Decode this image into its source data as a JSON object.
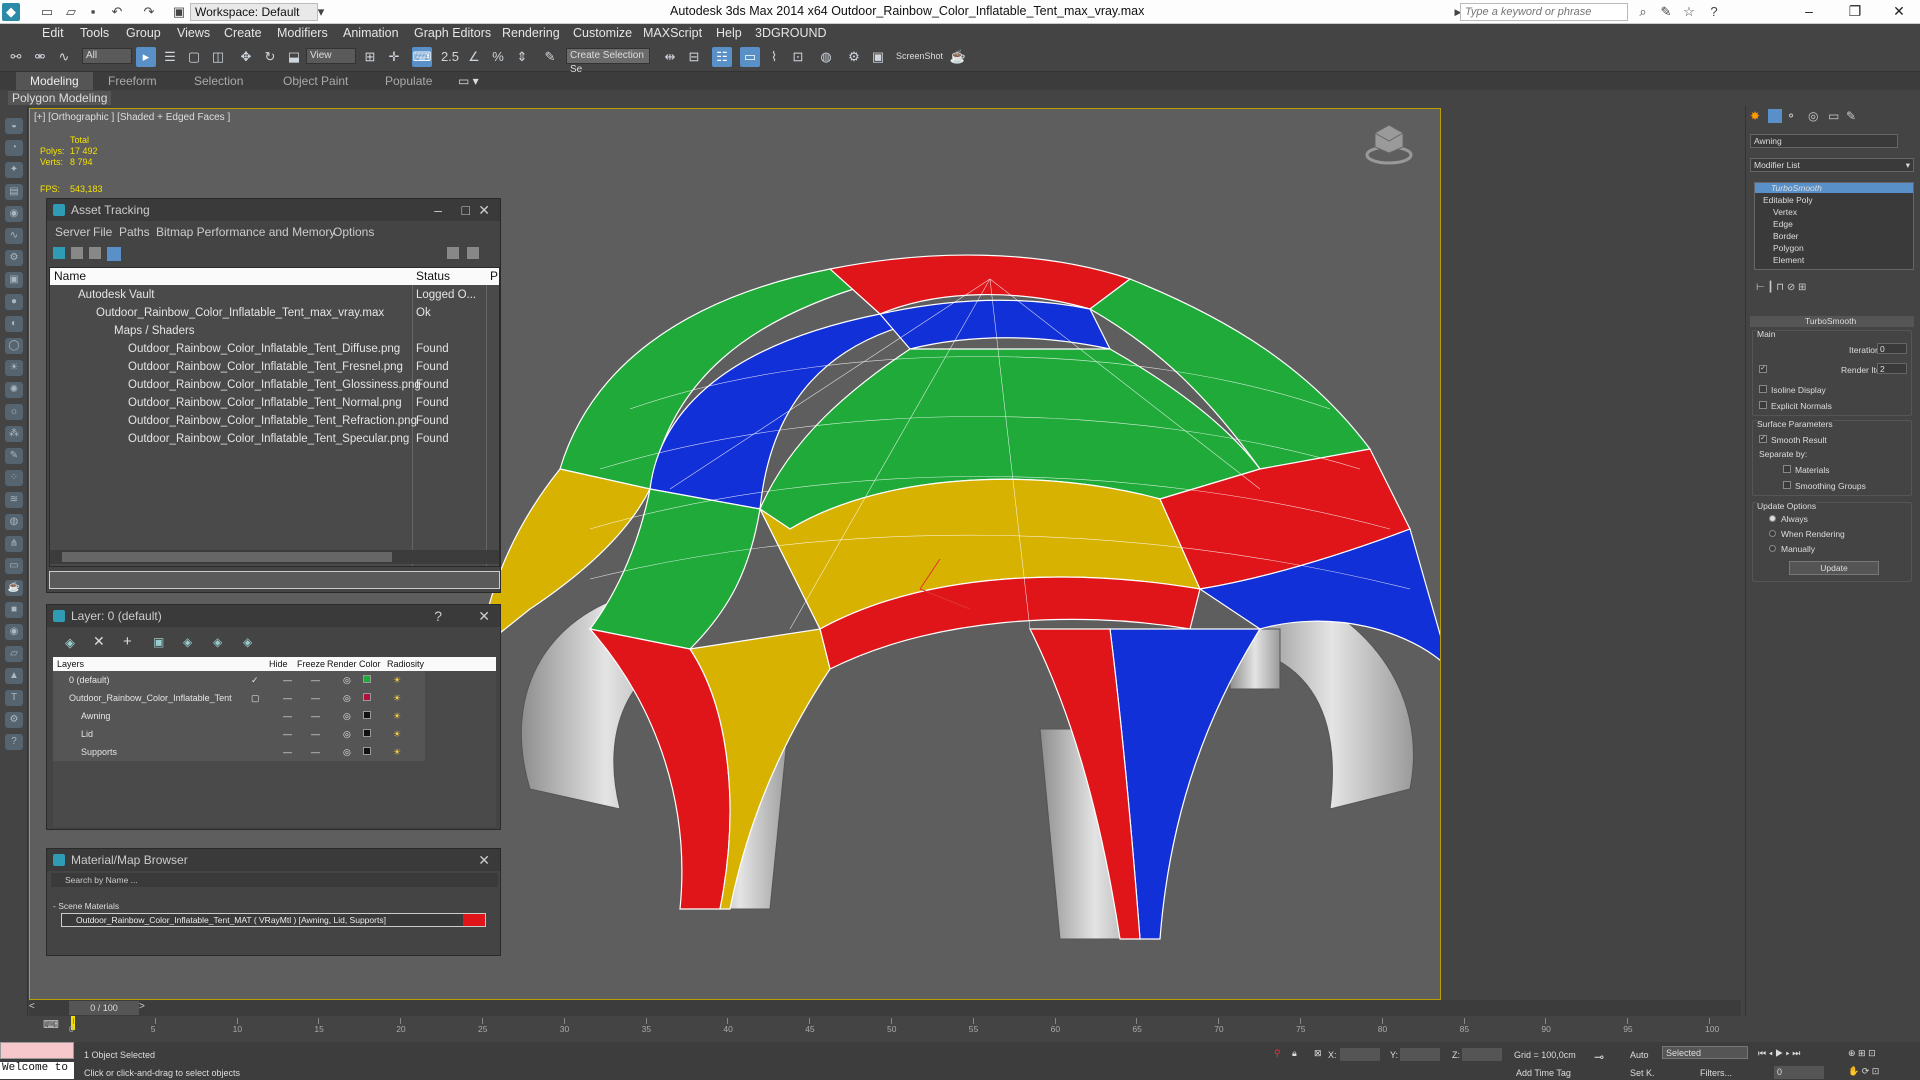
{
  "app": {
    "title": "Autodesk 3ds Max  2014 x64     Outdoor_Rainbow_Color_Inflatable_Tent_max_vray.max",
    "workspace": "Workspace: Default",
    "search_placeholder": "Type a keyword or phrase"
  },
  "menu": [
    "Edit",
    "Tools",
    "Group",
    "Views",
    "Create",
    "Modifiers",
    "Animation",
    "Graph Editors",
    "Rendering",
    "Customize",
    "MAXScript",
    "Help",
    "3DGROUND"
  ],
  "toolbar": {
    "filter_value": "All",
    "refcoord_value": "View",
    "named_sel_value": "Create Selection Se",
    "screenshot_label": "ScreenShot"
  },
  "ribbon": {
    "tabs": [
      "Modeling",
      "Freeform",
      "Selection",
      "Object Paint",
      "Populate"
    ],
    "active_tab": "Modeling",
    "sub_tab": "Polygon Modeling"
  },
  "viewport": {
    "label": "[+] [Orthographic ] [Shaded + Edged Faces ]",
    "stats_total": "Total",
    "polys_label": "Polys:",
    "polys_value": "17 492",
    "verts_label": "Verts:",
    "verts_value": "8 794",
    "fps_label": "FPS:",
    "fps_value": "543,183",
    "colors": {
      "green": "#1faa3a",
      "red": "#e0151a",
      "blue": "#1230d8",
      "yellow": "#d8b200",
      "grey": "#d2d2d2"
    }
  },
  "asset_tracking": {
    "title": "Asset Tracking",
    "menu": [
      "Server",
      "File",
      "Paths",
      "Bitmap Performance and Memory",
      "Options"
    ],
    "col_name": "Name",
    "col_status": "Status",
    "col_p": "P",
    "rows": [
      {
        "name": "Autodesk Vault",
        "status": "Logged O..."
      },
      {
        "name": "Outdoor_Rainbow_Color_Inflatable_Tent_max_vray.max",
        "status": "Ok"
      },
      {
        "name": "Maps / Shaders",
        "status": ""
      },
      {
        "name": "Outdoor_Rainbow_Color_Inflatable_Tent_Diffuse.png",
        "status": "Found"
      },
      {
        "name": "Outdoor_Rainbow_Color_Inflatable_Tent_Fresnel.png",
        "status": "Found"
      },
      {
        "name": "Outdoor_Rainbow_Color_Inflatable_Tent_Glossiness.png",
        "status": "Found"
      },
      {
        "name": "Outdoor_Rainbow_Color_Inflatable_Tent_Normal.png",
        "status": "Found"
      },
      {
        "name": "Outdoor_Rainbow_Color_Inflatable_Tent_Refraction.png",
        "status": "Found"
      },
      {
        "name": "Outdoor_Rainbow_Color_Inflatable_Tent_Specular.png",
        "status": "Found"
      }
    ]
  },
  "layer_panel": {
    "title": "Layer: 0 (default)",
    "help": "?",
    "cols": [
      "Layers",
      "Hide",
      "Freeze",
      "Render",
      "Color",
      "Radiosity"
    ],
    "rows": [
      {
        "name": "0 (default)",
        "color": "#1faa3a"
      },
      {
        "name": "Outdoor_Rainbow_Color_Inflatable_Tent",
        "color": "#b0103a"
      },
      {
        "name": "Awning",
        "color": "#111111"
      },
      {
        "name": "Lid",
        "color": "#111111"
      },
      {
        "name": "Supports",
        "color": "#111111"
      }
    ]
  },
  "material_browser": {
    "title": "Material/Map Browser",
    "search_placeholder": "Search by Name ...",
    "section": "- Scene Materials",
    "material": "Outdoor_Rainbow_Color_Inflatable_Tent_MAT ( VRayMtl ) [Awning, Lid, Supports]"
  },
  "command_panel": {
    "object_name": "Awning",
    "modifier_list": "Modifier List",
    "stack": [
      "TurboSmooth",
      "Editable Poly",
      "Vertex",
      "Edge",
      "Border",
      "Polygon",
      "Element"
    ],
    "rollout_title": "TurboSmooth",
    "main": "Main",
    "iterations_label": "Iterations:",
    "iterations_value": "0",
    "render_iters_label": "Render Iters:",
    "render_iters_value": "2",
    "isoline": "Isoline Display",
    "explicit_normals": "Explicit Normals",
    "surface_params": "Surface Parameters",
    "smooth_result": "Smooth Result",
    "separate_by": "Separate by:",
    "materials": "Materials",
    "smoothing_groups": "Smoothing Groups",
    "update_options": "Update Options",
    "always": "Always",
    "when_rendering": "When Rendering",
    "manually": "Manually",
    "update_btn": "Update"
  },
  "timeline": {
    "frame": "0 / 100",
    "ticks": [
      "0",
      "5",
      "10",
      "15",
      "20",
      "25",
      "30",
      "35",
      "40",
      "45",
      "50",
      "55",
      "60",
      "65",
      "70",
      "75",
      "80",
      "85",
      "90",
      "95",
      "100"
    ]
  },
  "status_bar": {
    "script_field": "Welcome to",
    "selection": "1 Object Selected",
    "prompt": "Click or click-and-drag to select objects",
    "x_label": "X:",
    "y_label": "Y:",
    "z_label": "Z:",
    "grid": "Grid = 100,0cm",
    "add_time_tag": "Add Time Tag",
    "auto": "Auto",
    "set_key": "Set K.",
    "selected": "Selected",
    "filters": "Filters...",
    "frame_value": "0"
  }
}
